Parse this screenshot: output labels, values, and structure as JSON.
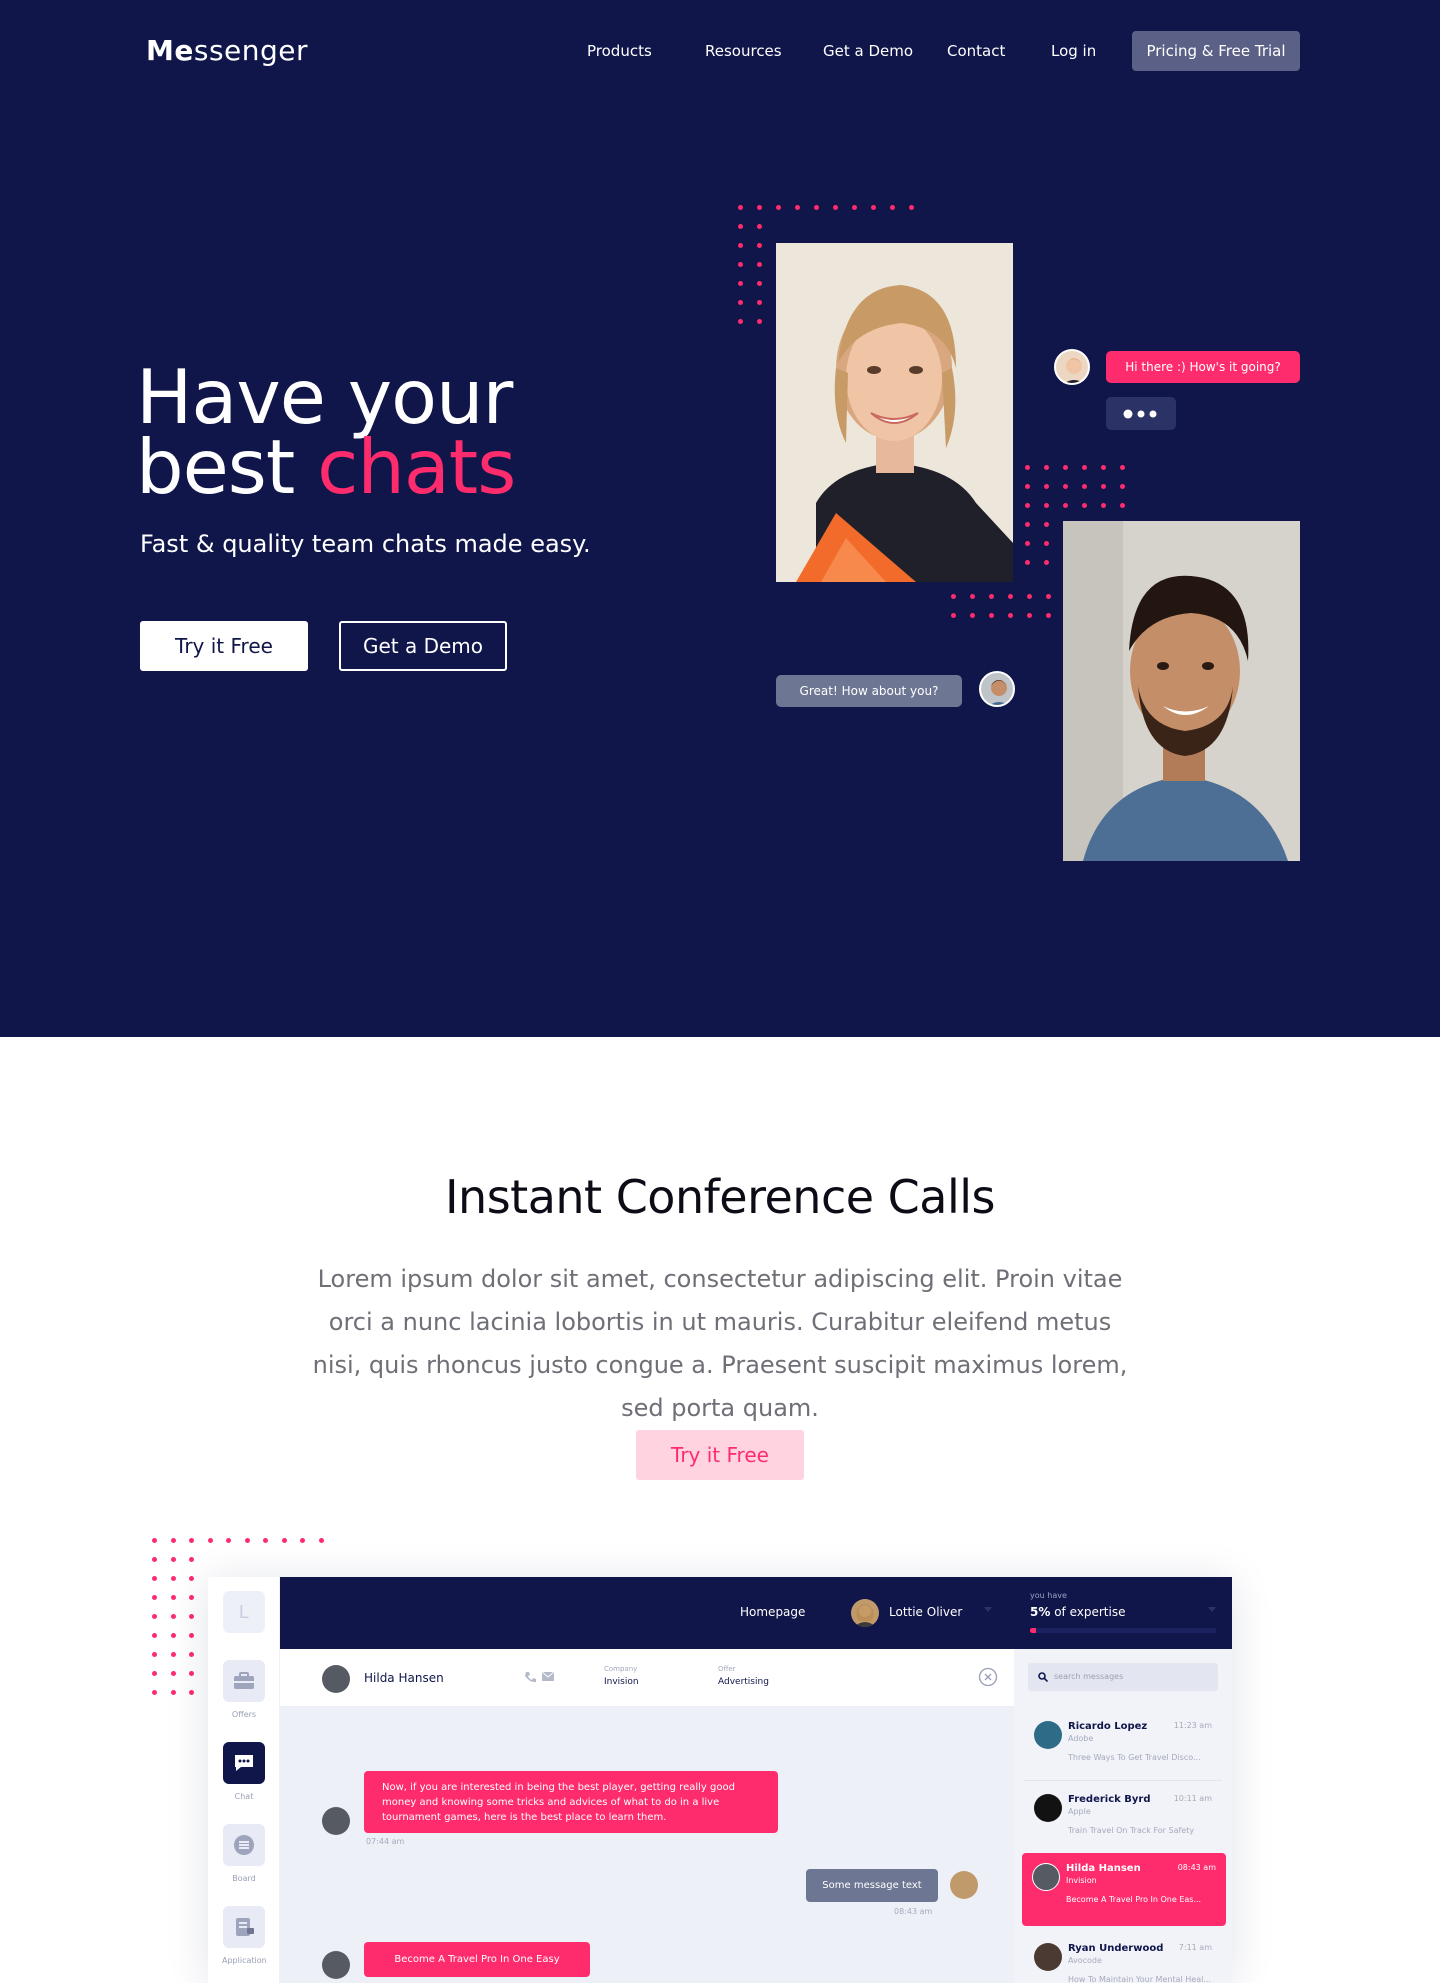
{
  "nav": {
    "logo_bold": "Me",
    "logo_rest": "ssenger",
    "links": [
      "Products",
      "Resources",
      "Get a Demo",
      "Contact",
      "Log in"
    ],
    "cta": "Pricing & Free Trial"
  },
  "hero": {
    "title_line1": "Have your",
    "title_line2_a": "best ",
    "title_line2_b": "chats",
    "subtitle": "Fast & quality team chats made easy.",
    "btn_try": "Try it Free",
    "btn_demo": "Get a Demo",
    "bubble_1": "Hi there :) How's it going?",
    "bubble_3": "Great! How about you?"
  },
  "section2": {
    "title": "Instant Conference Calls",
    "body": "Lorem ipsum dolor sit amet, consectetur adipiscing elit. Proin vitae orci a nunc lacinia lobortis in ut mauris. Curabitur eleifend metus nisi, quis rhoncus justo congue a. Praesent suscipit maximus lorem, sed porta quam.",
    "btn_try": "Try it Free"
  },
  "app": {
    "sidebar_logo": "L",
    "sidebar": [
      "Offers",
      "Chat",
      "Board",
      "Application"
    ],
    "topbar_homepage": "Homepage",
    "topbar_user": "Lottie Oliver",
    "expertise_small": "you have",
    "expertise_bold": "5%",
    "expertise_rest": " of expertise",
    "expertise_progress": 0.05,
    "contact_name": "Hilda Hansen",
    "company_label": "Company",
    "company_value": "Invision",
    "offer_label": "Offer",
    "offer_value": "Advertising",
    "search_placeholder": "search messages",
    "chat": {
      "msg1": "Now, if you are interested in being the best player, getting really good money and knowing some tricks and advices of what to do in a live tournament games, here is the best place to learn them.",
      "msg1_time": "07:44 am",
      "msg2": "Some message text",
      "msg2_time": "08:43 am",
      "msg3": "Become A Travel Pro In One Easy"
    },
    "messages": [
      {
        "name": "Ricardo Lopez",
        "company": "Adobe",
        "time": "11:23 am",
        "preview": "Three Ways To Get Travel Disco..."
      },
      {
        "name": "Frederick Byrd",
        "company": "Apple",
        "time": "10:11 am",
        "preview": "Train Travel On Track For Safety"
      },
      {
        "name": "Hilda Hansen",
        "company": "Invision",
        "time": "08:43 am",
        "preview": "Become A Travel Pro In One Eas..."
      },
      {
        "name": "Ryan Underwood",
        "company": "Avocode",
        "time": "7:11 am",
        "preview": "How To Maintain Your Mental Heal..."
      }
    ]
  },
  "colors": {
    "navy": "#10164a",
    "pink": "#ff2c6d",
    "grey_button": "#5b6186"
  }
}
